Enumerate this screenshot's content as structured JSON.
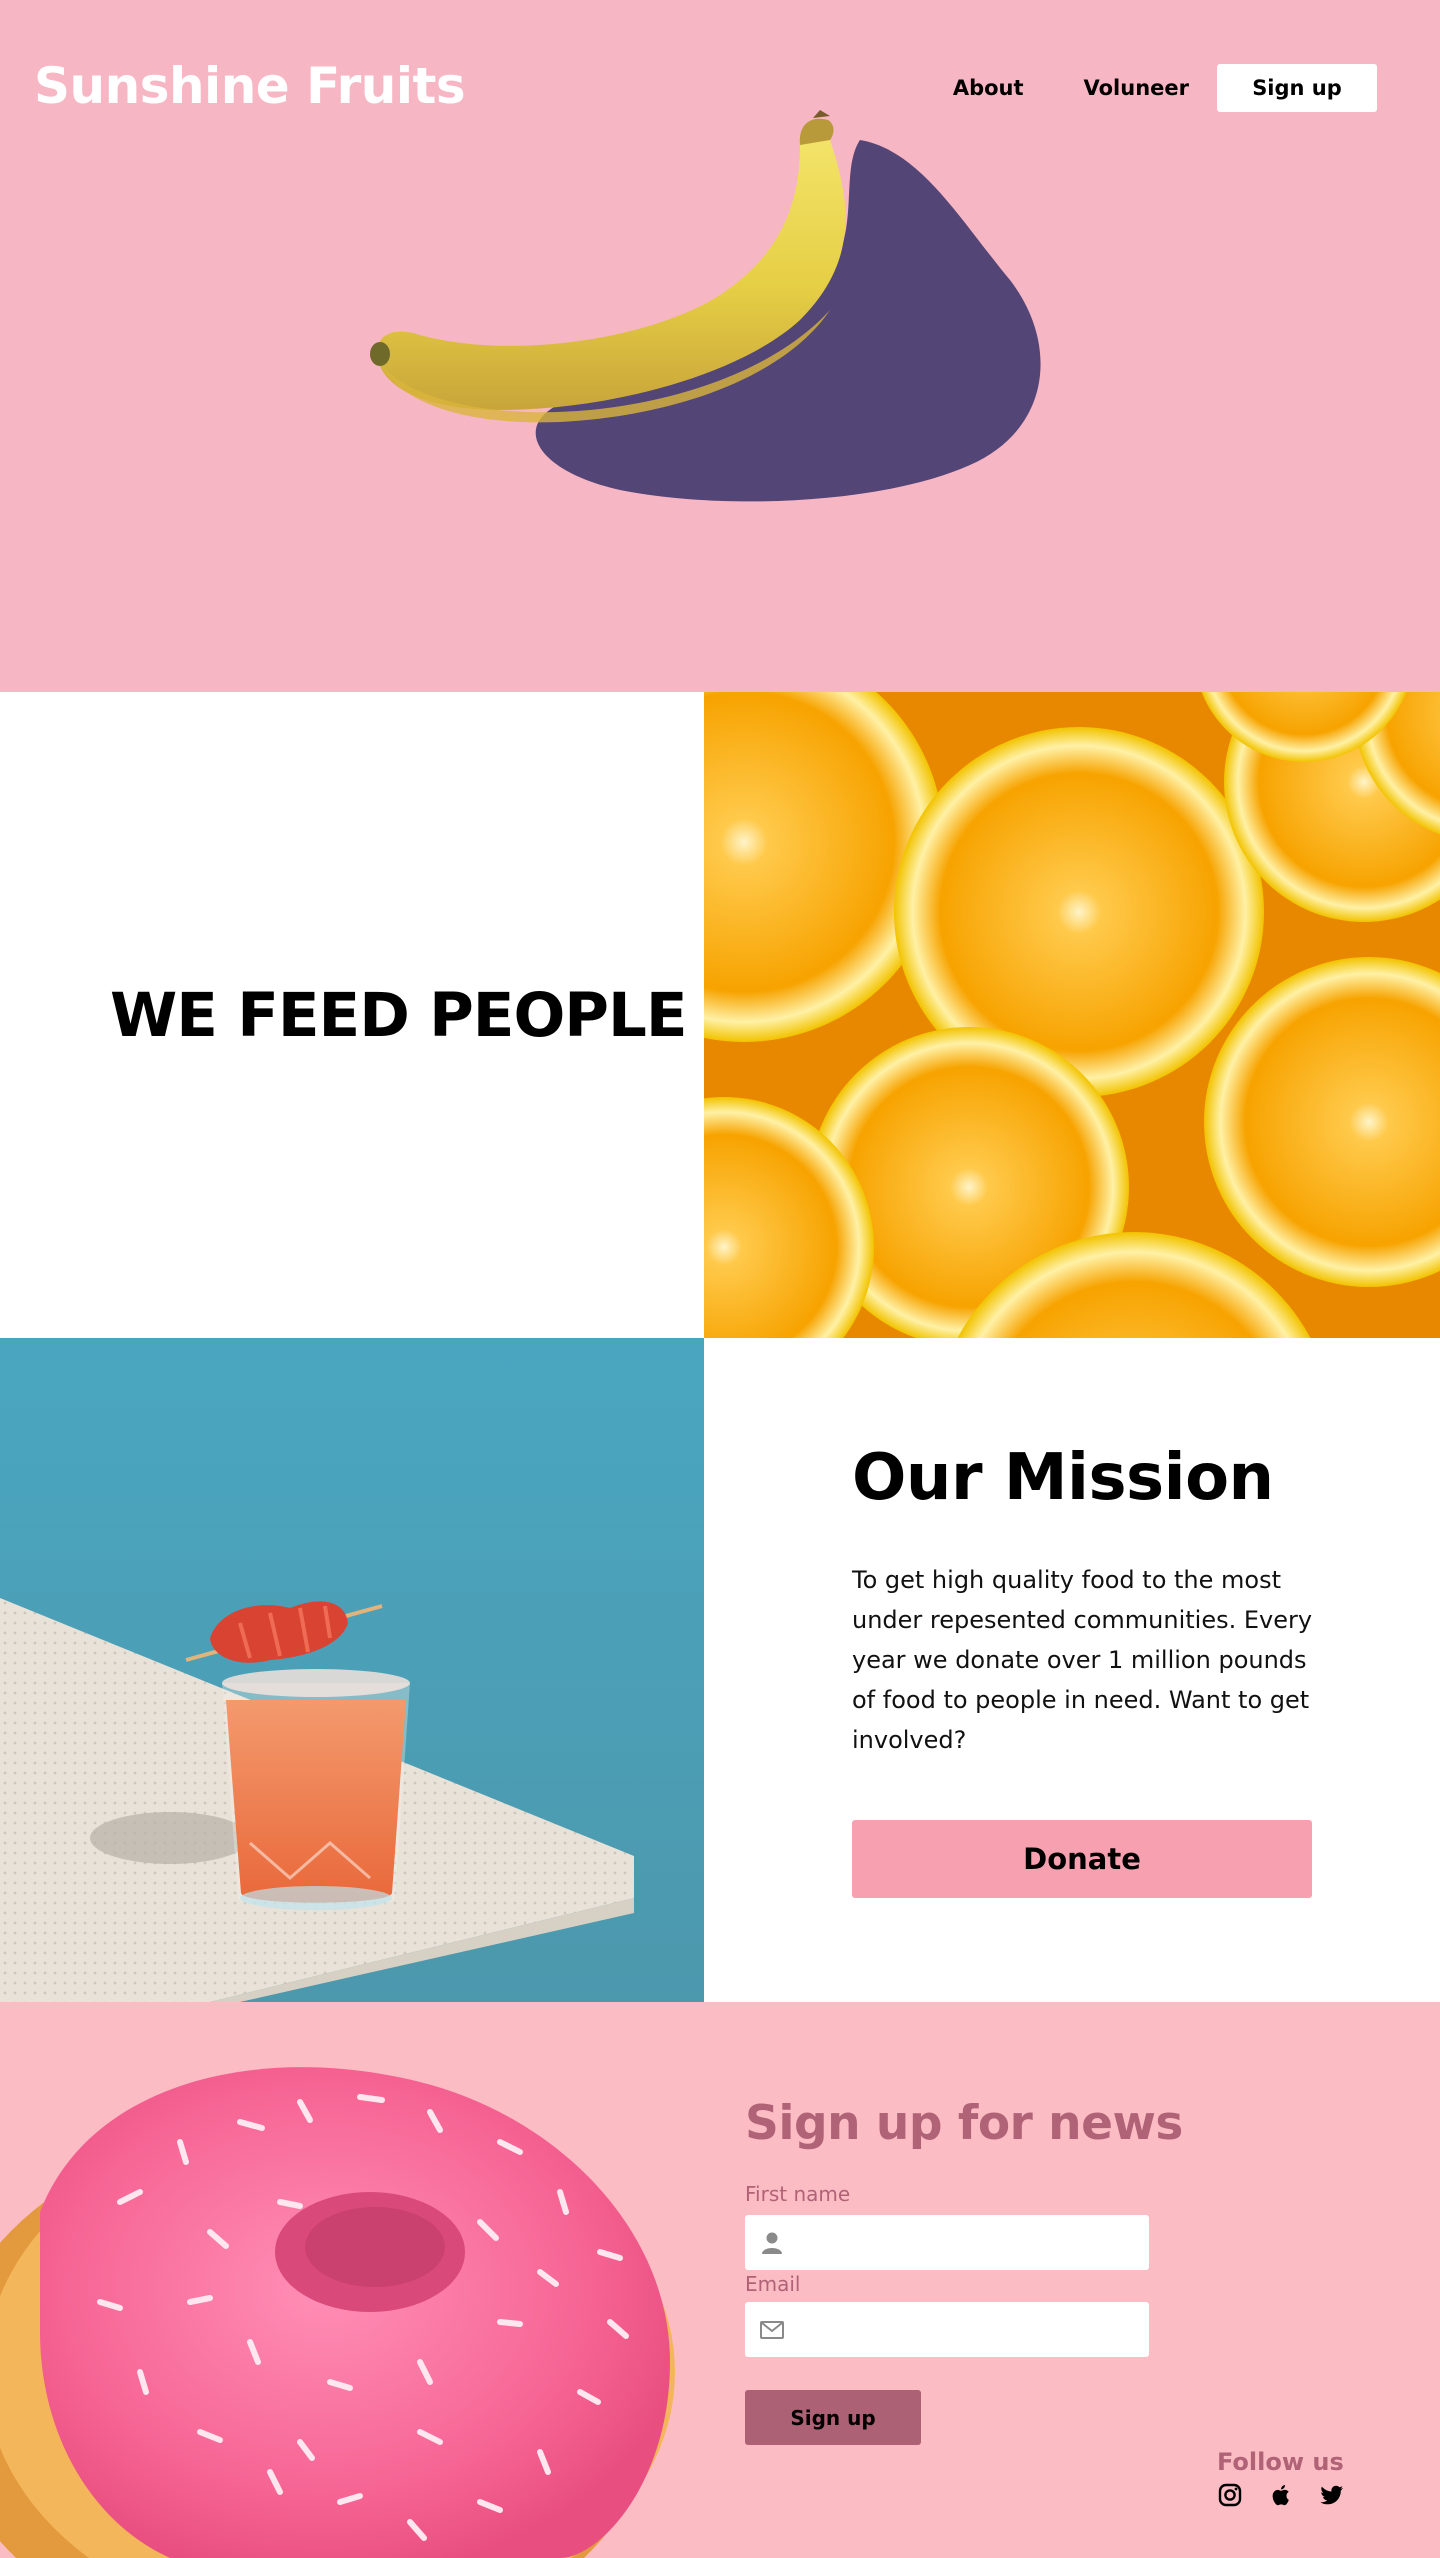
{
  "brand": "Sunshine Fruits",
  "nav": {
    "about": "About",
    "volunteer": "Voluneer",
    "signup": "Sign up"
  },
  "feed": {
    "title": "WE FEED PEOPLE"
  },
  "mission": {
    "title": "Our Mission",
    "text": "To get high quality food to the most under repesented communities. Every year we donate over 1 million pounds of food to people in need. Want to get involved?",
    "donate_label": "Donate"
  },
  "newsletter": {
    "title": "Sign up for news",
    "first_name_label": "First name",
    "first_name_value": "",
    "first_name_icon": "user-icon",
    "email_label": "Email",
    "email_value": "",
    "email_icon": "mail-icon",
    "submit_label": "Sign up",
    "follow_label": "Follow us",
    "social_icons": [
      "instagram-icon",
      "apple-icon",
      "twitter-icon"
    ]
  },
  "colors": {
    "hero_bg": "#f7b6c3",
    "accent_pink": "#f7a0b0",
    "news_bg": "#fcbcc4",
    "news_text": "#b06276",
    "drink_bg": "#4aa1b8",
    "orange": "#f29a00"
  }
}
